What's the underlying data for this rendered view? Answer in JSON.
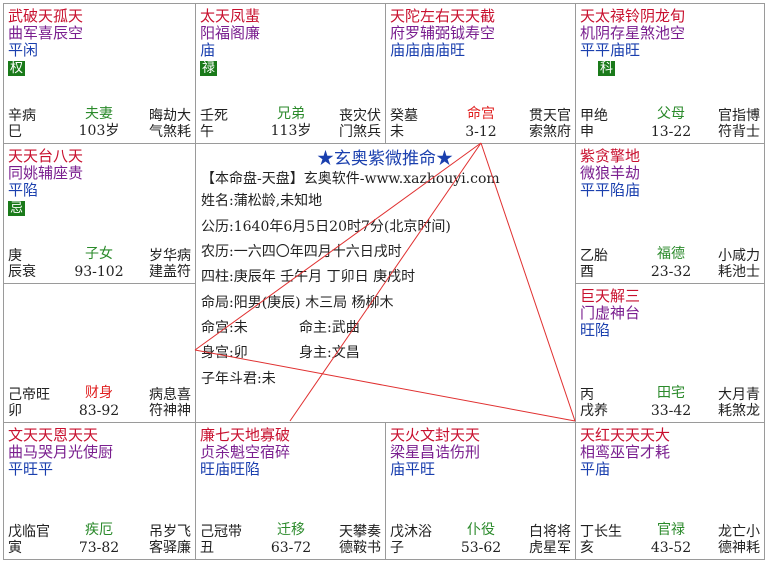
{
  "center": {
    "title": "★玄奥紫微推命★",
    "subtitle": "【本命盘-天盘】玄奥软件-www.xazhouyi.com",
    "name": "姓名:蒲松龄,未知地",
    "solar": "公历:1640年6月5日20时7分(北京时间)",
    "lunar": "农历:一六四〇年四月十六日戌时",
    "pillars": "四柱:庚辰年  壬午月  丁卯日  庚戌时",
    "ju": "命局:阳男(庚辰)    木三局  杨柳木",
    "minggong": "命宫:未",
    "mingzhu": "命主:武曲",
    "shengong": "身宫:卯",
    "shenzhu": "身主:文昌",
    "doujun": "子年斗君:未"
  },
  "cells": {
    "si": {
      "r1": "武破天孤天",
      "r2": "曲军喜辰空",
      "r3": "平闲",
      "badge": "权",
      "stem": "辛",
      "branch": "巳",
      "stage": "病",
      "palace": "夫妻",
      "age": "103岁",
      "br1": "晦劫大",
      "br2": "气煞耗"
    },
    "wu": {
      "r1": "太天凤蜚",
      "r2": "阳福阁廉",
      "r3": "庙",
      "badge": "禄",
      "stem": "壬",
      "branch": "午",
      "stage": "死",
      "palace": "兄弟",
      "age": "113岁",
      "br1": "丧灾伏",
      "br2": "门煞兵"
    },
    "wei": {
      "r1": "天陀左右天天截",
      "r2": "府罗辅弼钺寿空",
      "r3": "庙庙庙庙旺",
      "badge": "",
      "stem": "癸",
      "branch": "未",
      "stage": "墓",
      "palace": "命宫",
      "age": "3-12",
      "br1": "贯天官",
      "br2": "索煞府"
    },
    "shen": {
      "r1": "天太禄铃阴龙旬",
      "r2": "机阴存星煞池空",
      "r3": "平平庙旺",
      "badge": "科",
      "stem": "甲",
      "branch": "申",
      "stage": "绝",
      "palace": "父母",
      "age": "13-22",
      "br1": "官指博",
      "br2": "符背士"
    },
    "chen": {
      "r1": "天天台八天",
      "r2": "同姚辅座贵",
      "r3": "平陷",
      "badge": "忌",
      "stem": "庚",
      "branch": "辰",
      "stage": "衰",
      "palace": "子女",
      "age": "93-102",
      "br1": "岁华病",
      "br2": "建盖符"
    },
    "you": {
      "r1": "紫贪擎地",
      "r2": "微狼羊劫",
      "r3": "平平陷庙",
      "badge": "",
      "stem": "乙",
      "branch": "酉",
      "stage": "胎",
      "palace": "福德",
      "age": "23-32",
      "br1": "小咸力",
      "br2": "耗池士"
    },
    "mao": {
      "r1": "",
      "r2": "",
      "r3": "",
      "badge": "",
      "stem": "己",
      "branch": "卯",
      "stage": "帝旺",
      "palace": "财身",
      "age": "83-92",
      "br1": "病息喜",
      "br2": "符神神"
    },
    "xu": {
      "r1": "巨天解三",
      "r2": "门虚神台",
      "r3": "旺陷",
      "badge": "",
      "stem": "丙",
      "branch": "戌",
      "stage": "养",
      "palace": "田宅",
      "age": "33-42",
      "br1": "大月青",
      "br2": "耗煞龙"
    },
    "yin": {
      "r1": "文天天恩天天",
      "r2": "曲马哭月光使厨",
      "r3": "平旺平",
      "badge": "",
      "stem": "戊",
      "branch": "寅",
      "stage": "临官",
      "palace": "疾厄",
      "age": "73-82",
      "br1": "吊岁飞",
      "br2": "客驿廉"
    },
    "chou": {
      "r1": "廉七天地寡破",
      "r2": "贞杀魁空宿碎",
      "r3": "旺庙旺陷",
      "badge": "",
      "stem": "己",
      "branch": "丑",
      "stage": "冠带",
      "palace": "迁移",
      "age": "63-72",
      "br1": "天攀奏",
      "br2": "德鞍书"
    },
    "zi": {
      "r1": "天火文封天天",
      "r2": "梁星昌诰伤刑",
      "r3": "庙平旺",
      "badge": "",
      "stem": "戊",
      "branch": "子",
      "stage": "沐浴",
      "palace": "仆役",
      "age": "53-62",
      "br1": "白将将",
      "br2": "虎星军"
    },
    "hai": {
      "r1": "天红天天天大",
      "r2": "相鸾巫官才耗",
      "r3": "平庙",
      "badge": "",
      "stem": "丁",
      "branch": "亥",
      "stage": "长生",
      "palace": "官禄",
      "age": "43-52",
      "br1": "龙亡小",
      "br2": "德神耗"
    }
  }
}
